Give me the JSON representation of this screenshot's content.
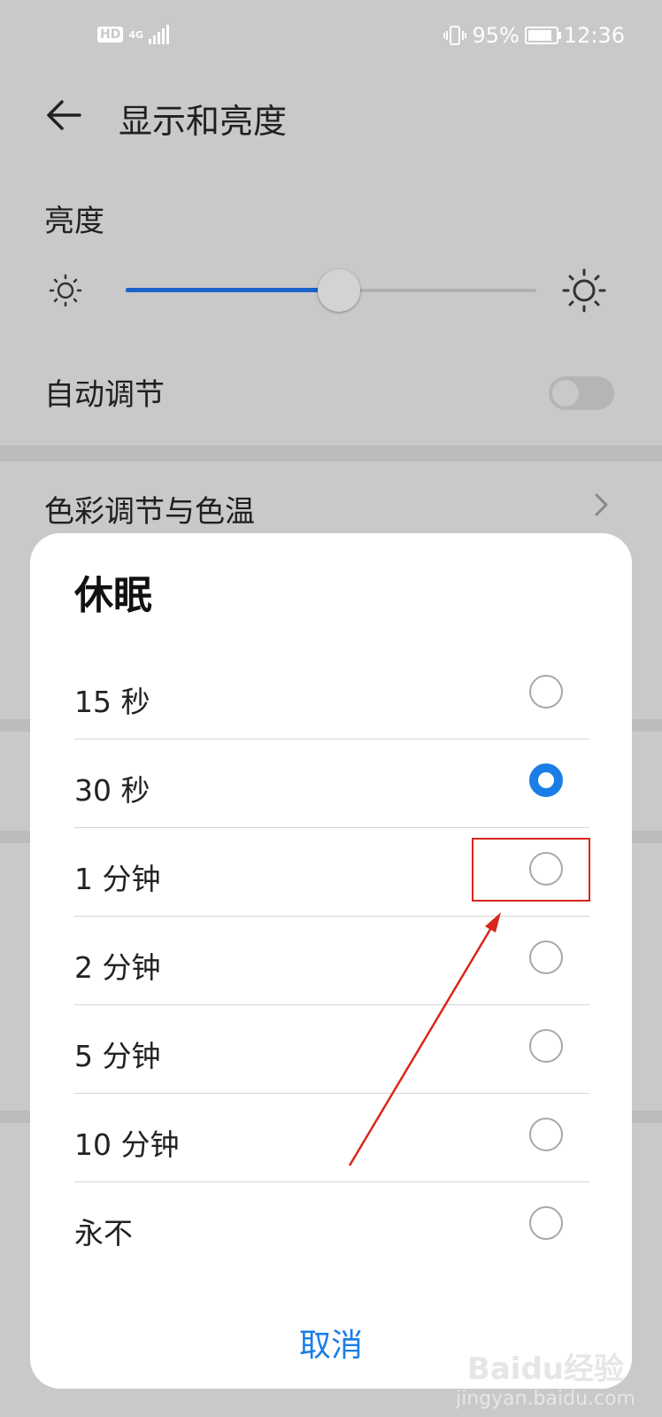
{
  "status_bar": {
    "hd": "HD",
    "network": "4G",
    "battery": "95%",
    "time": "12:36"
  },
  "header": {
    "title": "显示和亮度"
  },
  "settings": {
    "brightness_label": "亮度",
    "brightness_level": 0.52,
    "auto_adjust_label": "自动调节",
    "auto_adjust_on": false,
    "color_label": "色彩调节与色温"
  },
  "dialog": {
    "title": "休眠",
    "options": [
      {
        "label": "15 秒",
        "selected": false
      },
      {
        "label": "30 秒",
        "selected": true
      },
      {
        "label": "1 分钟",
        "selected": false
      },
      {
        "label": "2 分钟",
        "selected": false
      },
      {
        "label": "5 分钟",
        "selected": false
      },
      {
        "label": "10 分钟",
        "selected": false
      },
      {
        "label": "永不",
        "selected": false
      }
    ],
    "cancel_label": "取消"
  },
  "watermark": {
    "brand": "Baidu经验",
    "site": "jingyan.baidu.com"
  },
  "colors": {
    "accent": "#1a7ee6",
    "slider": "#1b63c9",
    "annotation": "#d9261c"
  }
}
